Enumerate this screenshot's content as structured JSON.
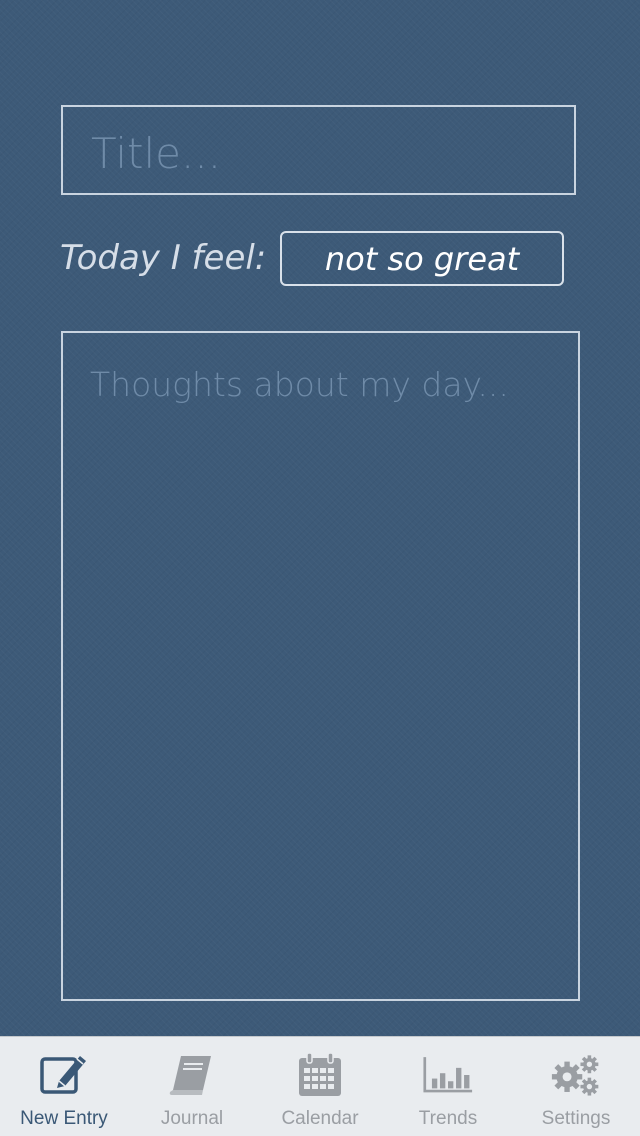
{
  "entry": {
    "title_placeholder": "Title...",
    "feel_label": "Today I feel:",
    "mood_value": "not so great",
    "thoughts_placeholder": "Thoughts about my day..."
  },
  "tabbar": {
    "tabs": [
      {
        "label": "New Entry",
        "icon": "new-entry-icon",
        "active": true
      },
      {
        "label": "Journal",
        "icon": "journal-icon",
        "active": false
      },
      {
        "label": "Calendar",
        "icon": "calendar-icon",
        "active": false
      },
      {
        "label": "Trends",
        "icon": "trends-icon",
        "active": false
      },
      {
        "label": "Settings",
        "icon": "settings-icon",
        "active": false
      }
    ]
  },
  "colors": {
    "background": "#3d5a78",
    "tab_active": "#3a5876",
    "tab_inactive": "#9a9ea3"
  }
}
